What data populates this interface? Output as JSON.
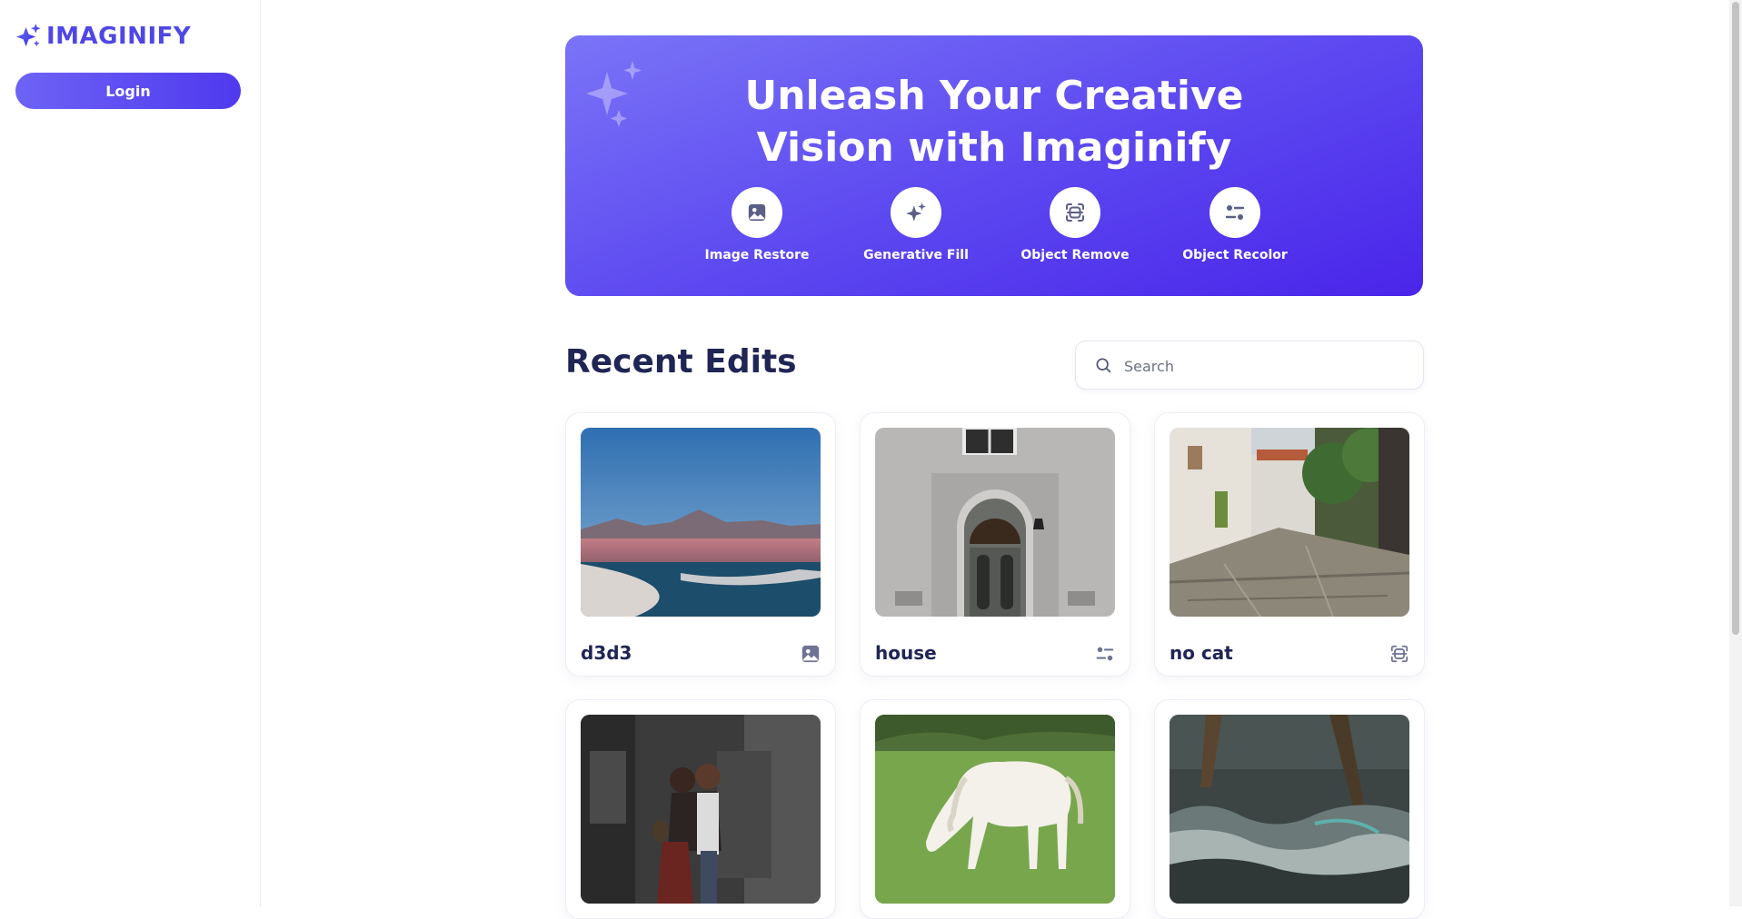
{
  "app": {
    "name": "IMAGINIFY",
    "brand_color": "#4f46e5",
    "logo_icon": "sparkles-icon"
  },
  "sidebar": {
    "login_label": "Login"
  },
  "hero": {
    "title_line1": "Unleash Your Creative",
    "title_line2": "Vision with Imaginify",
    "gradient": [
      "#7a74f7",
      "#4a25ea"
    ],
    "tools": [
      {
        "label": "Image Restore",
        "icon": "image-restore-icon"
      },
      {
        "label": "Generative Fill",
        "icon": "generative-fill-icon"
      },
      {
        "label": "Object Remove",
        "icon": "object-remove-icon"
      },
      {
        "label": "Object Recolor",
        "icon": "object-recolor-icon"
      }
    ]
  },
  "recent": {
    "title": "Recent Edits",
    "search_placeholder": "Search",
    "items": [
      {
        "title": "d3d3",
        "type_icon": "image-restore-icon",
        "image": "desert lagoon with mountains"
      },
      {
        "title": "house",
        "type_icon": "object-recolor-icon",
        "image": "grey stone house door"
      },
      {
        "title": "no cat",
        "type_icon": "object-remove-icon",
        "image": "cobblestone village street"
      },
      {
        "title": "",
        "type_icon": "",
        "image": "couple walking on street"
      },
      {
        "title": "",
        "type_icon": "",
        "image": "white horse grazing"
      },
      {
        "title": "",
        "type_icon": "",
        "image": "ocean waves with poles"
      }
    ]
  }
}
